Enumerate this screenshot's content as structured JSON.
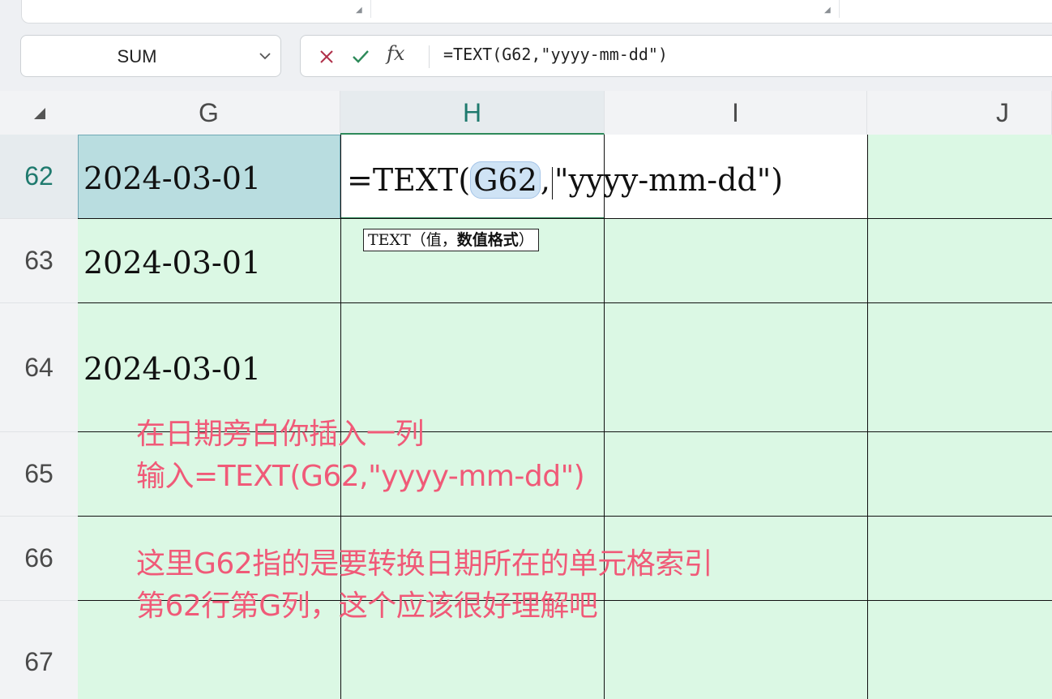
{
  "name_box": {
    "value": "SUM"
  },
  "formula_bar": {
    "fx_label": "fx",
    "content": "=TEXT(G62,\"yyyy-mm-dd\")"
  },
  "columns": [
    "G",
    "H",
    "I",
    "J"
  ],
  "active_column": "H",
  "rows": [
    "62",
    "63",
    "64",
    "65",
    "66",
    "67"
  ],
  "active_row": "62",
  "cells": {
    "G62": "2024-03-01",
    "G63": "2024-03-01",
    "G64": "2024-03-01"
  },
  "edit": {
    "prefix": "=TEXT(",
    "ref": "G62",
    "comma": ",",
    "suffix": "\"yyyy-mm-dd\")"
  },
  "tooltip": {
    "func": "TEXT",
    "args_open": "（值，",
    "arg_bold": "数值格式",
    "args_close": "）"
  },
  "annotations": [
    "在日期旁白你插入一列",
    "输入=TEXT(G62,\"yyyy-mm-dd\")",
    "这里G62指的是要转换日期所在的单元格索引",
    "第62行第G列，这个应该很好理解吧"
  ],
  "colors": {
    "accent_teal": "#1f7a6e",
    "sheet_bg": "#dbf8e4",
    "annotation": "#f05a78",
    "selected_cell": "#b9dde0"
  }
}
